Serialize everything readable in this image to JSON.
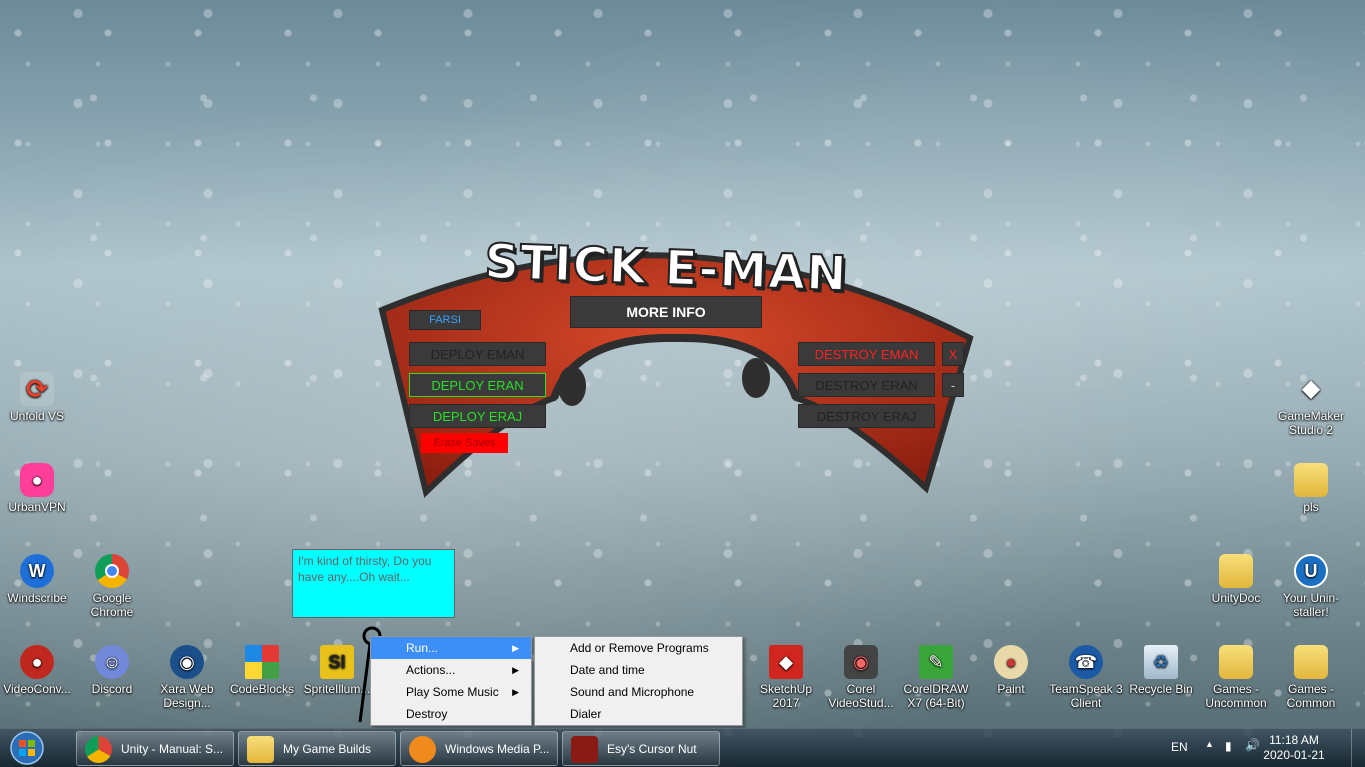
{
  "game": {
    "title": "STICK E-MAN",
    "more_info": "MORE INFO",
    "farsi": "FARSI",
    "deploy": [
      "DEPLOY EMAN",
      "DEPLOY ERAN",
      "DEPLOY ERAJ"
    ],
    "destroy": [
      "DESTROY EMAN",
      "DESTROY ERAN",
      "DESTROY ERAJ"
    ],
    "close": "X",
    "minimize": "-",
    "erase_saves": "Erase Saves"
  },
  "bubble": {
    "text": "I'm kind of thirsty, Do you have any....Oh wait..."
  },
  "menu": {
    "items": [
      "Run...",
      "Actions...",
      "Play Some Music",
      "Destroy"
    ],
    "submenu": [
      "Add or Remove Programs",
      "Date and time",
      "Sound and Microphone",
      "Dialer"
    ]
  },
  "desktop_icons": {
    "unfold": "Unfold VS",
    "urbanvpn": "UrbanVPN",
    "windscribe": "Windscribe",
    "chrome": "Google Chrome",
    "videoconv": "VideoConv...",
    "discord": "Discord",
    "xara": "Xara Web Design...",
    "codeblocks": "CodeBlocks",
    "spriteillum": "SpriteIllum...",
    "sketchup": "SketchUp 2017",
    "corelvideo": "Corel VideoStud...",
    "coreldraw": "CorelDRAW X7 (64-Bit)",
    "paint": "Paint",
    "teamspeak": "TeamSpeak 3 Client",
    "recycle": "Recycle Bin",
    "games_uncommon": "Games - Uncommon",
    "games_common": "Games - Common",
    "gamemaker": "GameMaker Studio 2",
    "pls": "pls",
    "unitydoc": "UnityDoc",
    "uninstaller": "Your Unin-staller!"
  },
  "taskbar": {
    "items": [
      "Unity - Manual: S...",
      "My Game Builds",
      "Windows Media P...",
      "Esy's Cursor Nut"
    ],
    "lang": "EN",
    "time": "11:18 AM",
    "date": "2020-01-21"
  },
  "colors": {
    "panel_red": "#b8321c",
    "deploy_green": "#28e028",
    "destroy_red": "#ff2020",
    "bubble": "#00ffff",
    "menu_highlight": "#3d8ef7"
  }
}
